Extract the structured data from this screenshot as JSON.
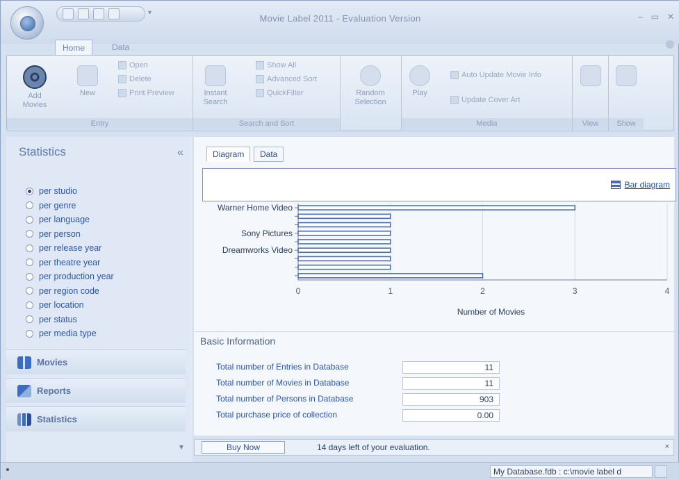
{
  "window": {
    "title": "Movie Label 2011 - Evaluation Version"
  },
  "tabs": [
    {
      "label": "Home"
    },
    {
      "label": "Data"
    }
  ],
  "ribbon": {
    "entry": {
      "add_movies": "Add Movies",
      "new": "New",
      "open": "Open",
      "delete": "Delete",
      "print_preview": "Print Preview",
      "label": "Entry"
    },
    "search_sort": {
      "instant_search": "Instant Search",
      "show_all": "Show All",
      "advanced_sort": "Advanced Sort",
      "quickfilter": "QuickFilter",
      "label": "Search and Sort"
    },
    "random": {
      "label": "Random Selection"
    },
    "media": {
      "play": "Play",
      "auto_update": "Auto Update Movie Info",
      "update_cover": "Update Cover Art",
      "label": "Media"
    },
    "view": {
      "label": "View"
    },
    "show": {
      "label": "Show"
    }
  },
  "left_pane": {
    "title": "Statistics",
    "collapse_glyph": "«",
    "options": [
      {
        "label": "per studio",
        "checked": true
      },
      {
        "label": "per genre",
        "checked": false
      },
      {
        "label": "per language",
        "checked": false
      },
      {
        "label": "per person",
        "checked": false
      },
      {
        "label": "per release year",
        "checked": false
      },
      {
        "label": "per theatre year",
        "checked": false
      },
      {
        "label": "per production year",
        "checked": false
      },
      {
        "label": "per region code",
        "checked": false
      },
      {
        "label": "per location",
        "checked": false
      },
      {
        "label": "per status",
        "checked": false
      },
      {
        "label": "per media type",
        "checked": false
      }
    ],
    "nav": [
      {
        "label": "Movies"
      },
      {
        "label": "Reports"
      },
      {
        "label": "Statistics"
      }
    ]
  },
  "content_tabs": [
    {
      "label": "Diagram"
    },
    {
      "label": "Data"
    }
  ],
  "chart_toolbar": {
    "bar_diagram": "Bar diagram"
  },
  "chart_data": {
    "type": "bar",
    "orientation": "horizontal",
    "categories": [
      "Warner Home Video",
      "",
      "",
      "Sony Pictures",
      "",
      "Dreamworks Video",
      "",
      "",
      ""
    ],
    "values": [
      3,
      1,
      1,
      1,
      1,
      1,
      1,
      1,
      2
    ],
    "xlabel": "Number of Movies",
    "xlim": [
      0,
      4
    ],
    "xticks": [
      "0",
      "1",
      "2",
      "3",
      "4"
    ],
    "grid": true,
    "bar_color": "#4a6db4"
  },
  "basic_info": {
    "title": "Basic Information",
    "rows": [
      {
        "label": "Total number of Entries in Database",
        "value": "11"
      },
      {
        "label": "Total number of Movies in Database",
        "value": "11"
      },
      {
        "label": "Total number of Persons in Database",
        "value": "903"
      },
      {
        "label": "Total purchase price of collection",
        "value": "0.00"
      }
    ]
  },
  "eval_bar": {
    "buy_now": "Buy Now",
    "message": "14 days left of your evaluation.",
    "close": "×"
  },
  "status": {
    "path": "My Database.fdb  :  c:\\movie label d"
  }
}
